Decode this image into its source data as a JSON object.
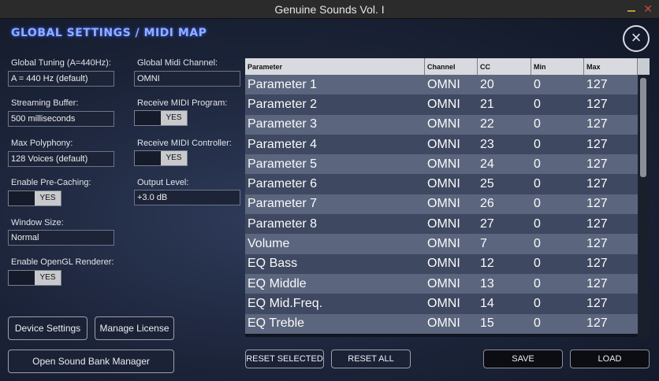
{
  "window": {
    "title": "Genuine Sounds Vol. I"
  },
  "heading": "GLOBAL SETTINGS / MIDI MAP",
  "close_glyph": "×",
  "left": {
    "global_tuning": {
      "label": "Global Tuning (A=440Hz):",
      "value": "A = 440 Hz (default)"
    },
    "streaming_buffer": {
      "label": "Streaming Buffer:",
      "value": "500 milliseconds"
    },
    "max_polyphony": {
      "label": "Max Polyphony:",
      "value": "128 Voices (default)"
    },
    "pre_caching": {
      "label": "Enable Pre-Caching:",
      "value": "YES"
    },
    "window_size": {
      "label": "Window Size:",
      "value": "Normal"
    },
    "opengl": {
      "label": "Enable OpenGL Renderer:",
      "value": "YES"
    }
  },
  "middle": {
    "midi_channel": {
      "label": "Global Midi Channel:",
      "value": "OMNI"
    },
    "receive_program": {
      "label": "Receive MIDI Program:",
      "value": "YES"
    },
    "receive_controller": {
      "label": "Receive MIDI Controller:",
      "value": "YES"
    },
    "output_level": {
      "label": "Output Level:",
      "value": "+3.0 dB"
    }
  },
  "buttons": {
    "device_settings": "Device Settings",
    "manage_license": "Manage License",
    "open_sound_bank": "Open Sound Bank Manager",
    "reset_selected": "RESET SELECTED",
    "reset_all": "RESET ALL",
    "save": "SAVE",
    "load": "LOAD"
  },
  "table": {
    "headers": [
      "Parameter",
      "Channel",
      "CC",
      "Min",
      "Max"
    ],
    "rows": [
      [
        "Parameter 1",
        "OMNI",
        "20",
        "0",
        "127"
      ],
      [
        "Parameter 2",
        "OMNI",
        "21",
        "0",
        "127"
      ],
      [
        "Parameter 3",
        "OMNI",
        "22",
        "0",
        "127"
      ],
      [
        "Parameter 4",
        "OMNI",
        "23",
        "0",
        "127"
      ],
      [
        "Parameter 5",
        "OMNI",
        "24",
        "0",
        "127"
      ],
      [
        "Parameter 6",
        "OMNI",
        "25",
        "0",
        "127"
      ],
      [
        "Parameter 7",
        "OMNI",
        "26",
        "0",
        "127"
      ],
      [
        "Parameter 8",
        "OMNI",
        "27",
        "0",
        "127"
      ],
      [
        "Volume",
        "OMNI",
        "7",
        "0",
        "127"
      ],
      [
        "EQ Bass",
        "OMNI",
        "12",
        "0",
        "127"
      ],
      [
        "EQ Middle",
        "OMNI",
        "13",
        "0",
        "127"
      ],
      [
        "EQ Mid.Freq.",
        "OMNI",
        "14",
        "0",
        "127"
      ],
      [
        "EQ Treble",
        "OMNI",
        "15",
        "0",
        "127"
      ]
    ]
  }
}
